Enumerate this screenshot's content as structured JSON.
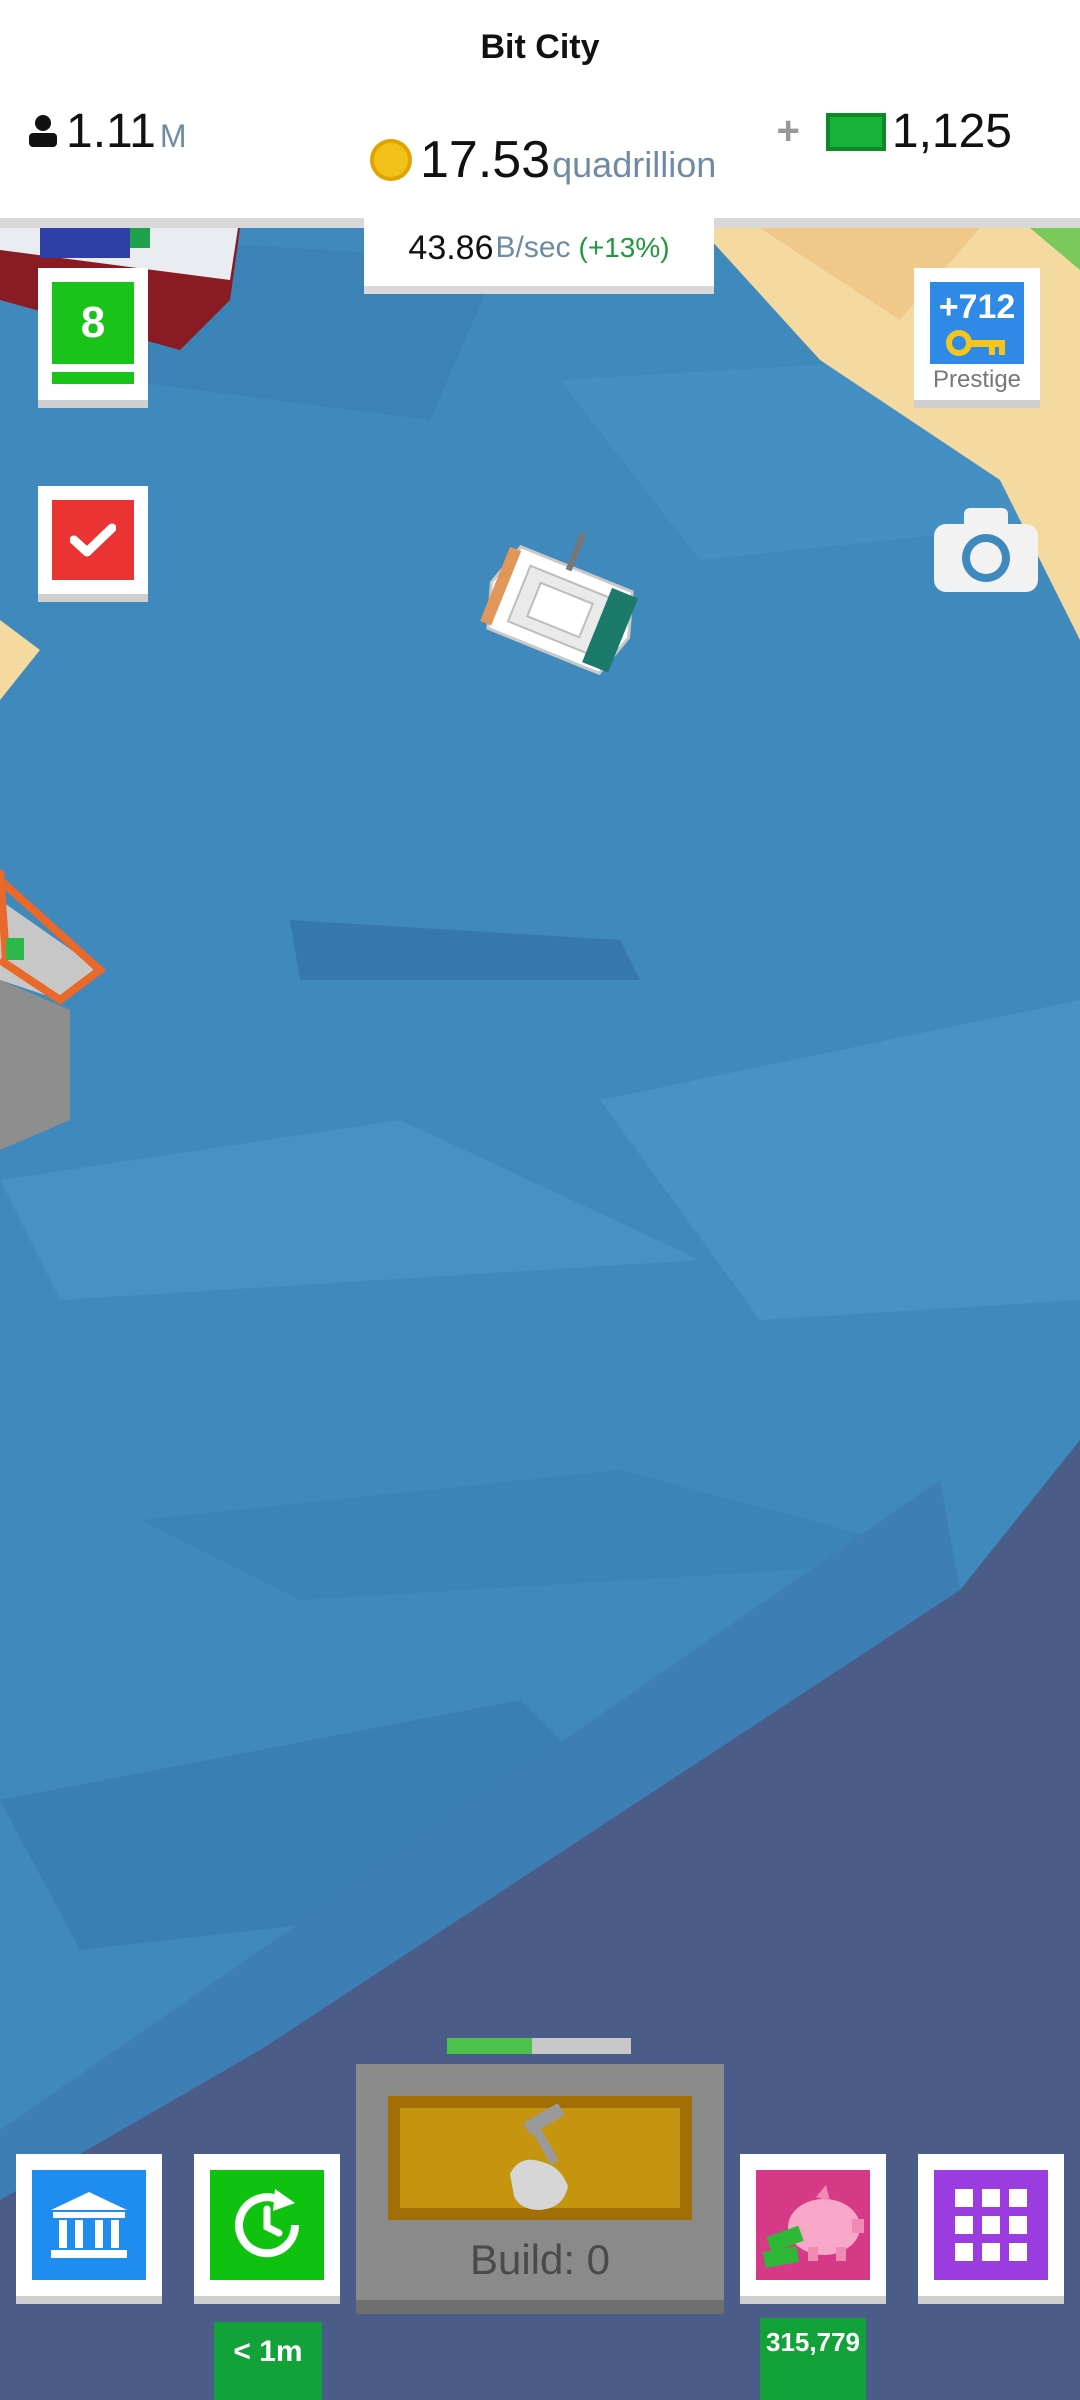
{
  "header": {
    "title": "Bit City",
    "population": {
      "value": "1.11",
      "unit": "M"
    },
    "coins": {
      "value": "17.53",
      "unit": "quadrillion"
    },
    "cash": {
      "plus": "+",
      "value": "1,125"
    },
    "income": {
      "value": "43.86",
      "unit": "B/sec",
      "bonus": "(+13%)"
    }
  },
  "side": {
    "level": "8",
    "prestige": {
      "value": "+712",
      "label": "Prestige"
    }
  },
  "bottom": {
    "build_label": "Build: 0",
    "build_progress": 0.46,
    "boost_timer": "< 1m",
    "savings": "315,779"
  },
  "colors": {
    "water": "#3f89bd",
    "deep_water": "#4b5c88",
    "sand": "#f4d9a0",
    "accent_green": "#13a13a"
  }
}
